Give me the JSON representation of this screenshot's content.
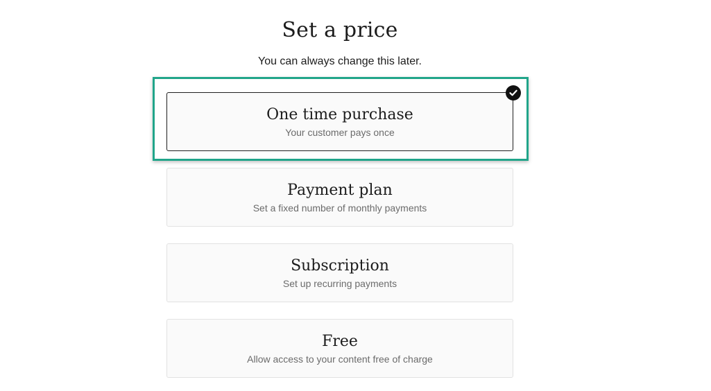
{
  "header": {
    "title": "Set a price",
    "subtitle": "You can always change this later."
  },
  "options": [
    {
      "title": "One time purchase",
      "description": "Your customer pays once",
      "selected": true
    },
    {
      "title": "Payment plan",
      "description": "Set a fixed number of monthly payments",
      "selected": false
    },
    {
      "title": "Subscription",
      "description": "Set up recurring payments",
      "selected": false
    },
    {
      "title": "Free",
      "description": "Allow access to your content free of charge",
      "selected": false
    }
  ],
  "icons": {
    "selected_indicator": "check-circle-icon"
  },
  "colors": {
    "highlight": "#21a58a",
    "selected_border": "#1f1f1f",
    "card_background": "#fafafa",
    "check_badge": "#111111"
  }
}
